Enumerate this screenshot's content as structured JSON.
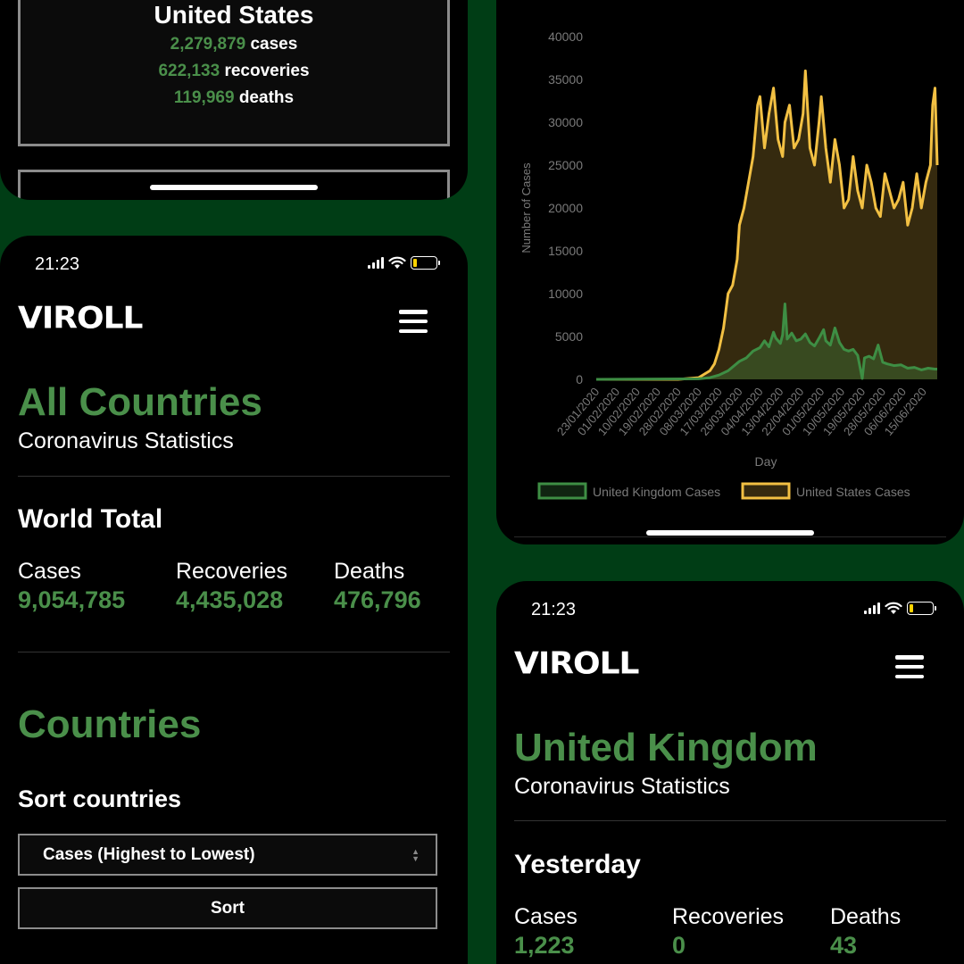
{
  "top_card": {
    "title": "United States",
    "cases_value": "2,279,879",
    "cases_label": "cases",
    "recoveries_value": "622,133",
    "recoveries_label": "recoveries",
    "deaths_value": "119,969",
    "deaths_label": "deaths"
  },
  "phone_all": {
    "time": "21:23",
    "logo": "VIROLL",
    "title": "All Countries",
    "subtitle": "Coronavirus Statistics",
    "world_total_title": "World Total",
    "stats": [
      {
        "label": "Cases",
        "value": "9,054,785"
      },
      {
        "label": "Recoveries",
        "value": "4,435,028"
      },
      {
        "label": "Deaths",
        "value": "476,796"
      }
    ],
    "countries_title": "Countries",
    "sort_title": "Sort countries",
    "sort_select": "Cases (Highest to Lowest)",
    "sort_button": "Sort"
  },
  "phone_uk": {
    "time": "21:23",
    "logo": "VIROLL",
    "title": "United Kingdom",
    "subtitle": "Coronavirus Statistics",
    "yesterday_title": "Yesterday",
    "stats": [
      {
        "label": "Cases",
        "value": "1,223"
      },
      {
        "label": "Recoveries",
        "value": "0"
      },
      {
        "label": "Deaths",
        "value": "43"
      }
    ]
  },
  "colors": {
    "accent_green": "#4a8f4a",
    "us_line": "#f2c043",
    "uk_line": "#3e8e44"
  },
  "chart_data": {
    "type": "area",
    "xlabel": "Day",
    "ylabel": "Number of Cases",
    "ylim": [
      0,
      40000
    ],
    "yticks": [
      0,
      5000,
      10000,
      15000,
      20000,
      25000,
      30000,
      35000,
      40000
    ],
    "xticks": [
      "23/01/2020",
      "01/02/2020",
      "10/02/2020",
      "19/02/2020",
      "28/02/2020",
      "08/03/2020",
      "17/03/2020",
      "26/03/2020",
      "04/04/2020",
      "13/04/2020",
      "22/04/2020",
      "01/05/2020",
      "10/05/2020",
      "19/05/2020",
      "28/05/2020",
      "06/06/2020",
      "15/06/2020"
    ],
    "legend_position": "bottom",
    "series": [
      {
        "name": "United Kingdom Cases",
        "color": "#3e8e44",
        "points": [
          [
            "23/01/2020",
            0
          ],
          [
            "08/03/2020",
            60
          ],
          [
            "13/03/2020",
            200
          ],
          [
            "17/03/2020",
            500
          ],
          [
            "21/03/2020",
            1000
          ],
          [
            "26/03/2020",
            2100
          ],
          [
            "29/03/2020",
            2500
          ],
          [
            "01/04/2020",
            3300
          ],
          [
            "04/04/2020",
            3700
          ],
          [
            "06/04/2020",
            4500
          ],
          [
            "08/04/2020",
            3800
          ],
          [
            "10/04/2020",
            5500
          ],
          [
            "11/04/2020",
            4800
          ],
          [
            "13/04/2020",
            4200
          ],
          [
            "14/04/2020",
            5200
          ],
          [
            "15/04/2020",
            8800
          ],
          [
            "16/04/2020",
            4700
          ],
          [
            "18/04/2020",
            5400
          ],
          [
            "20/04/2020",
            4500
          ],
          [
            "22/04/2020",
            4700
          ],
          [
            "24/04/2020",
            5300
          ],
          [
            "26/04/2020",
            4300
          ],
          [
            "28/04/2020",
            3900
          ],
          [
            "30/04/2020",
            4800
          ],
          [
            "02/05/2020",
            5800
          ],
          [
            "03/05/2020",
            4500
          ],
          [
            "05/05/2020",
            4000
          ],
          [
            "07/05/2020",
            6000
          ],
          [
            "09/05/2020",
            4300
          ],
          [
            "11/05/2020",
            3500
          ],
          [
            "13/05/2020",
            3300
          ],
          [
            "15/05/2020",
            3500
          ],
          [
            "17/05/2020",
            2800
          ],
          [
            "19/05/2020",
            100
          ],
          [
            "20/05/2020",
            2500
          ],
          [
            "22/05/2020",
            2700
          ],
          [
            "24/05/2020",
            2400
          ],
          [
            "26/05/2020",
            4000
          ],
          [
            "28/05/2020",
            2000
          ],
          [
            "30/05/2020",
            1800
          ],
          [
            "02/06/2020",
            1600
          ],
          [
            "05/06/2020",
            1700
          ],
          [
            "08/06/2020",
            1300
          ],
          [
            "11/06/2020",
            1400
          ],
          [
            "14/06/2020",
            1100
          ],
          [
            "17/06/2020",
            1300
          ],
          [
            "20/06/2020",
            1200
          ],
          [
            "21/06/2020",
            1200
          ]
        ]
      },
      {
        "name": "United States Cases",
        "color": "#f2c043",
        "points": [
          [
            "23/01/2020",
            0
          ],
          [
            "28/02/2020",
            0
          ],
          [
            "08/03/2020",
            200
          ],
          [
            "13/03/2020",
            1000
          ],
          [
            "15/03/2020",
            1800
          ],
          [
            "17/03/2020",
            3500
          ],
          [
            "19/03/2020",
            6000
          ],
          [
            "21/03/2020",
            10000
          ],
          [
            "23/03/2020",
            11000
          ],
          [
            "25/03/2020",
            14000
          ],
          [
            "26/03/2020",
            18000
          ],
          [
            "28/03/2020",
            20000
          ],
          [
            "30/03/2020",
            23000
          ],
          [
            "01/04/2020",
            26000
          ],
          [
            "03/04/2020",
            32000
          ],
          [
            "04/04/2020",
            33000
          ],
          [
            "06/04/2020",
            27000
          ],
          [
            "08/04/2020",
            31000
          ],
          [
            "10/04/2020",
            34000
          ],
          [
            "12/04/2020",
            28000
          ],
          [
            "14/04/2020",
            26000
          ],
          [
            "15/04/2020",
            30000
          ],
          [
            "17/04/2020",
            32000
          ],
          [
            "19/04/2020",
            27000
          ],
          [
            "21/04/2020",
            28000
          ],
          [
            "23/04/2020",
            31000
          ],
          [
            "24/04/2020",
            36000
          ],
          [
            "26/04/2020",
            27000
          ],
          [
            "28/04/2020",
            25000
          ],
          [
            "30/04/2020",
            30000
          ],
          [
            "01/05/2020",
            33000
          ],
          [
            "03/05/2020",
            27000
          ],
          [
            "05/05/2020",
            23000
          ],
          [
            "07/05/2020",
            28000
          ],
          [
            "09/05/2020",
            25000
          ],
          [
            "11/05/2020",
            20000
          ],
          [
            "13/05/2020",
            21000
          ],
          [
            "15/05/2020",
            26000
          ],
          [
            "17/05/2020",
            22000
          ],
          [
            "19/05/2020",
            20000
          ],
          [
            "21/05/2020",
            25000
          ],
          [
            "23/05/2020",
            23000
          ],
          [
            "25/05/2020",
            20000
          ],
          [
            "27/05/2020",
            19000
          ],
          [
            "29/05/2020",
            24000
          ],
          [
            "31/05/2020",
            22000
          ],
          [
            "02/06/2020",
            20000
          ],
          [
            "04/06/2020",
            21000
          ],
          [
            "06/06/2020",
            23000
          ],
          [
            "08/06/2020",
            18000
          ],
          [
            "10/06/2020",
            20000
          ],
          [
            "12/06/2020",
            24000
          ],
          [
            "14/06/2020",
            20000
          ],
          [
            "16/06/2020",
            23000
          ],
          [
            "18/06/2020",
            25000
          ],
          [
            "19/06/2020",
            32000
          ],
          [
            "20/06/2020",
            34000
          ],
          [
            "21/06/2020",
            25000
          ]
        ]
      }
    ]
  }
}
